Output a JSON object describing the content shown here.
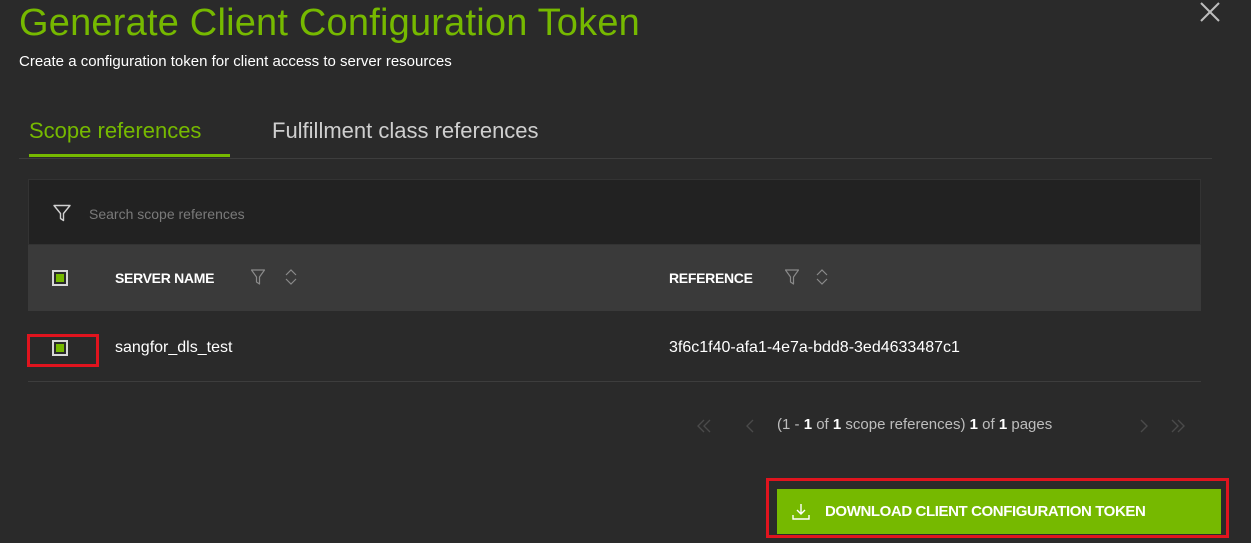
{
  "dialog": {
    "title": "Generate Client Configuration Token",
    "subtitle": "Create a configuration token for client access to server resources"
  },
  "tabs": [
    {
      "label": "Scope references",
      "active": true
    },
    {
      "label": "Fulfillment class references",
      "active": false
    }
  ],
  "search": {
    "placeholder": "Search scope references",
    "value": ""
  },
  "table": {
    "columns": [
      {
        "label": "SERVER NAME"
      },
      {
        "label": "REFERENCE"
      }
    ],
    "header_checkbox_checked": true,
    "rows": [
      {
        "server_name": "sangfor_dls_test",
        "reference": "3f6c1f40-afa1-4e7a-bdd8-3ed4633487c1",
        "checked": true
      }
    ]
  },
  "pagination": {
    "range_start": "1",
    "range_end": "1",
    "total": "1",
    "items_label": "scope references",
    "current_page": "1",
    "total_pages": "1",
    "pages_label": "pages"
  },
  "actions": {
    "download_label": "DOWNLOAD CLIENT CONFIGURATION TOKEN"
  },
  "colors": {
    "accent": "#76b900",
    "highlight": "#e0141e",
    "background": "#2a2a2a"
  },
  "icons": [
    "close-icon",
    "filter-icon",
    "sort-icon",
    "first-page-icon",
    "prev-page-icon",
    "next-page-icon",
    "last-page-icon",
    "download-icon"
  ]
}
